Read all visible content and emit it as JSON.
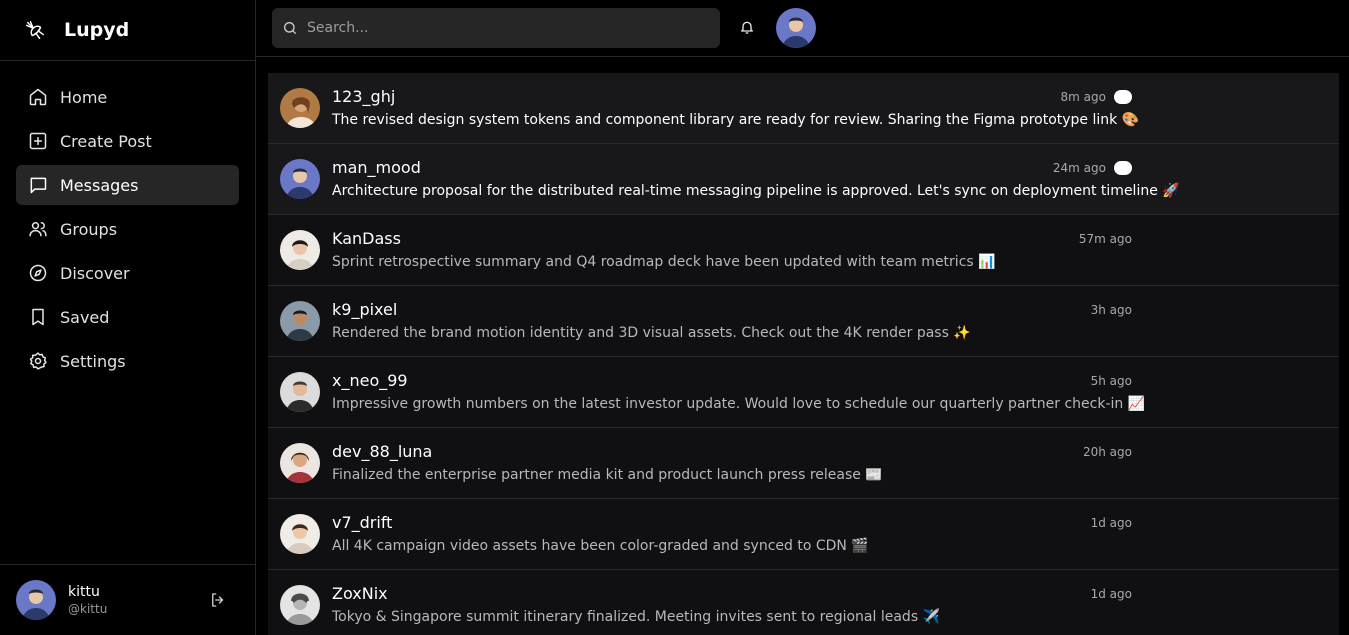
{
  "app": {
    "name": "Lupyd"
  },
  "nav": [
    {
      "label": "Home",
      "icon": "home-icon",
      "active": false
    },
    {
      "label": "Create Post",
      "icon": "plus-square-icon",
      "active": false
    },
    {
      "label": "Messages",
      "icon": "message-icon",
      "active": true
    },
    {
      "label": "Groups",
      "icon": "users-icon",
      "active": false
    },
    {
      "label": "Discover",
      "icon": "compass-icon",
      "active": false
    },
    {
      "label": "Saved",
      "icon": "bookmark-icon",
      "active": false
    },
    {
      "label": "Settings",
      "icon": "gear-icon",
      "active": false
    }
  ],
  "current_user": {
    "name": "kittu",
    "handle": "@kittu"
  },
  "search": {
    "placeholder": "Search..."
  },
  "messages": [
    {
      "name": "123_ghj",
      "text": "The revised design system tokens and component library are ready for review. Sharing the Figma prototype link 🎨",
      "time": "8m ago",
      "unread": true,
      "avatar_color": "#b07a45"
    },
    {
      "name": "man_mood",
      "text": "Architecture proposal for the distributed real-time messaging pipeline is approved. Let's sync on deployment timeline 🚀",
      "time": "24m ago",
      "unread": true,
      "avatar_color": "#6b78c8"
    },
    {
      "name": "KanDass",
      "text": "Sprint retrospective summary and Q4 roadmap deck have been updated with team metrics 📊",
      "time": "57m ago",
      "unread": false,
      "avatar_color": "#d8cfc4"
    },
    {
      "name": "k9_pixel",
      "text": "Rendered the brand motion identity and 3D visual assets. Check out the 4K render pass ✨",
      "time": "3h ago",
      "unread": false,
      "avatar_color": "#8a9aa8"
    },
    {
      "name": "x_neo_99",
      "text": "Impressive growth numbers on the latest investor update. Would love to schedule our quarterly partner check-in 📈",
      "time": "5h ago",
      "unread": false,
      "avatar_color": "#c9c9c9"
    },
    {
      "name": "dev_88_luna",
      "text": "Finalized the enterprise partner media kit and product launch press release 📰",
      "time": "20h ago",
      "unread": false,
      "avatar_color": "#a4333a"
    },
    {
      "name": "v7_drift",
      "text": "All 4K campaign video assets have been color-graded and synced to CDN 🎬",
      "time": "1d ago",
      "unread": false,
      "avatar_color": "#d6cbbe"
    },
    {
      "name": "ZoxNix",
      "text": "Tokyo & Singapore summit itinerary finalized. Meeting invites sent to regional leads ✈️",
      "time": "1d ago",
      "unread": false,
      "avatar_color": "#bfbfbf"
    }
  ]
}
